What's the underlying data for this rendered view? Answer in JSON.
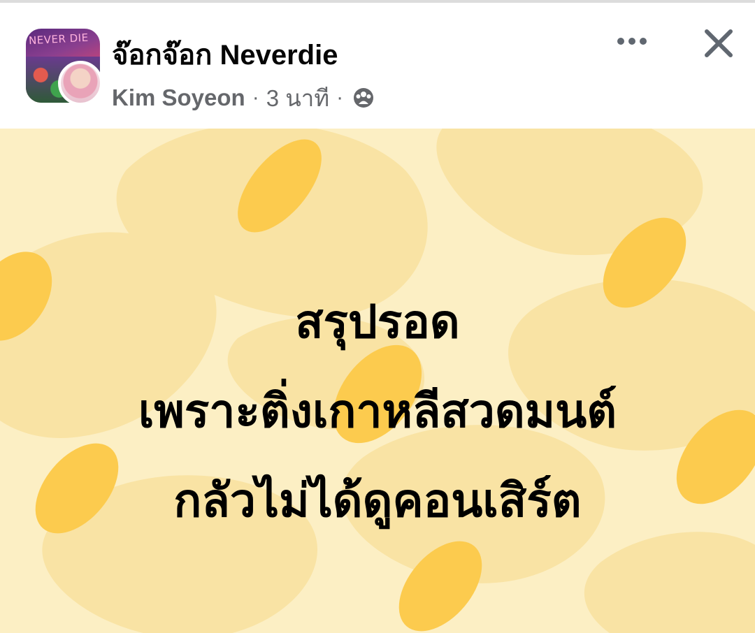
{
  "header": {
    "group_name": "จ๊อกจ๊อก Neverdie",
    "group_avatar_label": "NEVER DIE",
    "author": "Kim Soyeon",
    "separator": "·",
    "time": "3 นาที",
    "audience_icon": "group-audience-icon",
    "more_icon": "more-options-icon",
    "close_icon": "close-icon"
  },
  "post": {
    "lines": [
      "สรุปรอด",
      "เพราะติ่งเกาหลีสวดมนต์",
      "กลัวไม่ได้ดูคอนเสิร์ต"
    ],
    "background_color": "#fcefc4",
    "pattern_colors": [
      "#f9e4a6",
      "#fccb4e"
    ],
    "text_color": "#000000"
  },
  "colors": {
    "primary_text": "#050505",
    "secondary_text": "#65676b",
    "icon": "#606770"
  }
}
